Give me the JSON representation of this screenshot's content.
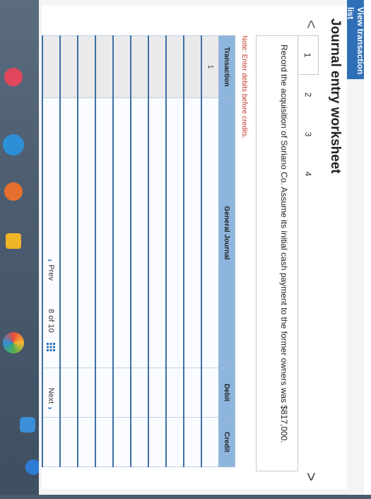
{
  "header": {
    "view_transaction_label": "View transaction list"
  },
  "worksheet": {
    "title": "Journal entry worksheet",
    "prev_arrow": "<",
    "next_arrow": ">",
    "steps": [
      "1",
      "2",
      "3",
      "4"
    ],
    "active_step": "1",
    "instruction": "Record the acquisition of Soriano Co. Assume its initial cash payment to the former owners was $817,000.",
    "note": "Note: Enter debits before credits."
  },
  "table": {
    "columns": [
      "Transaction",
      "General Journal",
      "Debit",
      "Credit"
    ],
    "rows": [
      {
        "transaction": "1"
      },
      {
        "transaction": ""
      },
      {
        "transaction": ""
      },
      {
        "transaction": ""
      },
      {
        "transaction": ""
      },
      {
        "transaction": ""
      },
      {
        "transaction": ""
      },
      {
        "transaction": ""
      },
      {
        "transaction": ""
      },
      {
        "transaction": ""
      }
    ]
  },
  "pagination": {
    "prev_label": "Prev",
    "counter": "8 of 10",
    "next_label": "Next"
  },
  "colors": {
    "accent": "#2f6fb7",
    "table_header": "#8eb5dd",
    "note_text": "#c0392b"
  }
}
